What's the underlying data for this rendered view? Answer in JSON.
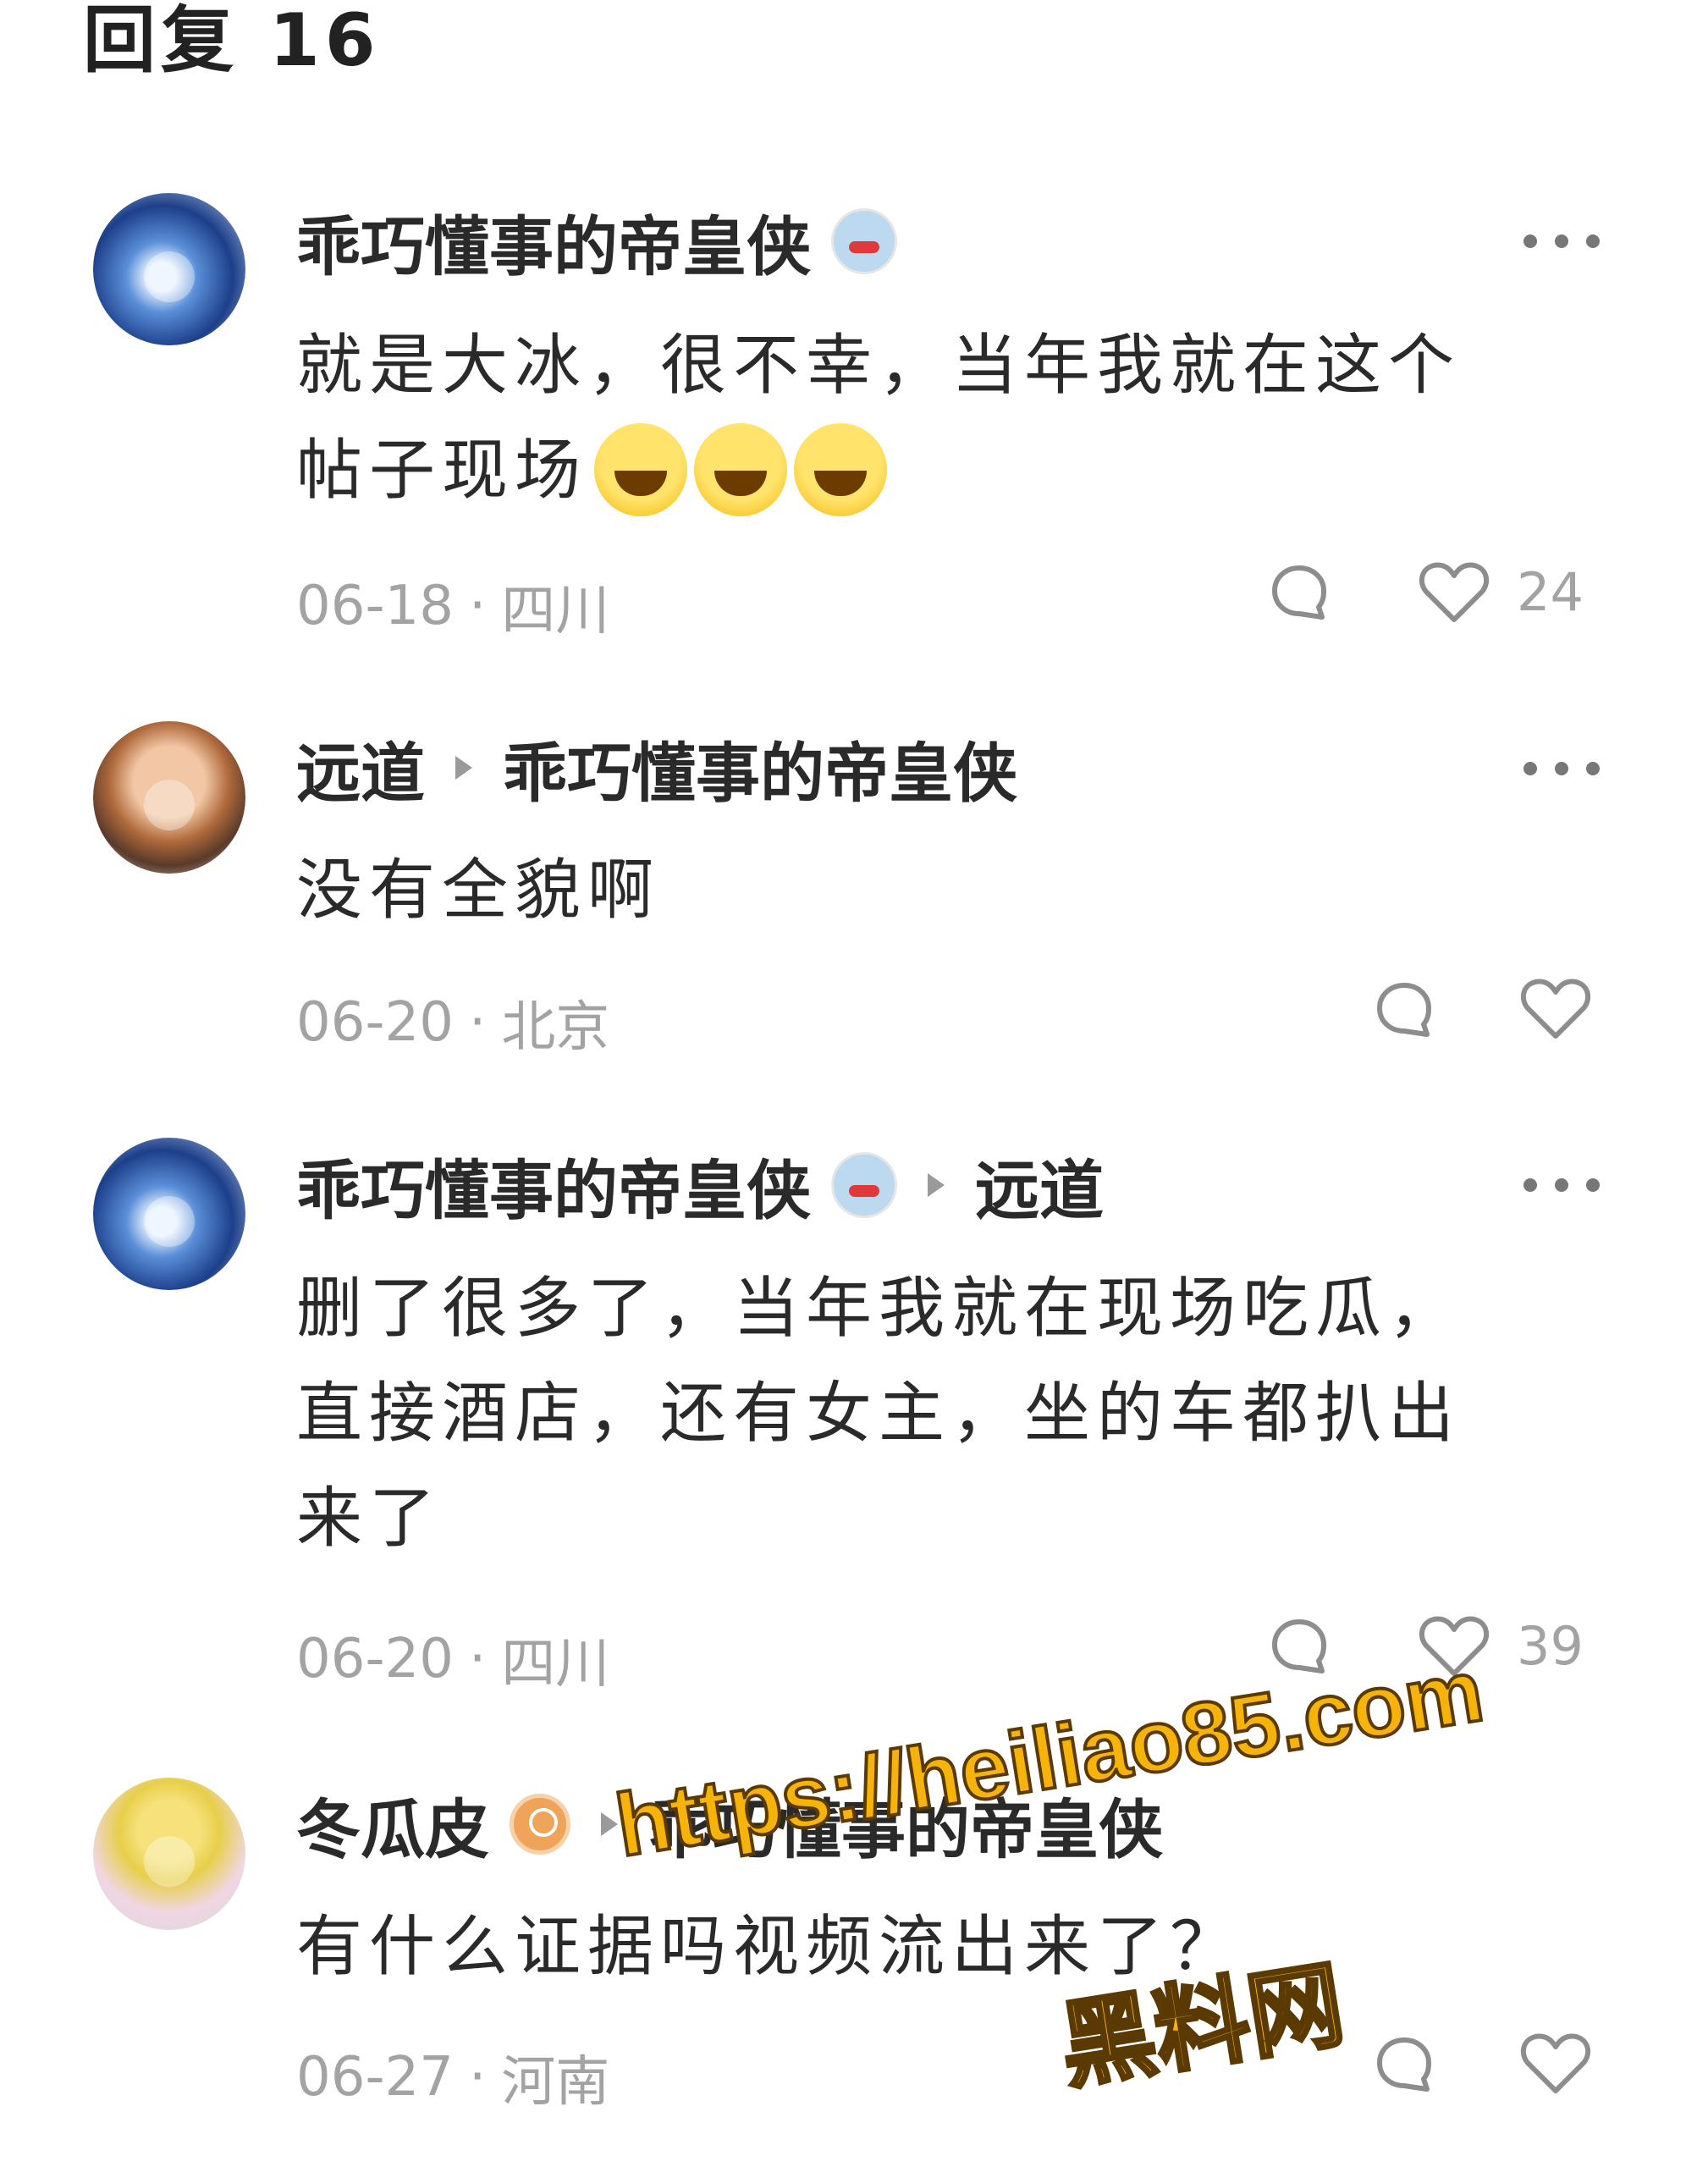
{
  "header": {
    "title": "回复 16"
  },
  "comments": [
    {
      "user": "乖巧懂事的帝皇侠",
      "has_badge": true,
      "reply_to": "",
      "text_lines": [
        "就是大冰，很不幸，当年我就在这个",
        "帖子现场"
      ],
      "emoji_count": 3,
      "date": "06-18",
      "location": "四川",
      "likes": "24"
    },
    {
      "user": "远道",
      "has_badge": false,
      "reply_to": "乖巧懂事的帝皇侠",
      "text_lines": [
        "没有全貌啊"
      ],
      "date": "06-20",
      "location": "北京",
      "likes": ""
    },
    {
      "user": "乖巧懂事的帝皇侠",
      "has_badge": true,
      "reply_to": "远道",
      "text_lines": [
        "删了很多了，当年我就在现场吃瓜，",
        "直接酒店，还有女主，坐的车都扒出",
        "来了"
      ],
      "date": "06-20",
      "location": "四川",
      "likes": "39"
    },
    {
      "user": "冬瓜皮",
      "has_badge": true,
      "reply_to": "乖巧懂事的帝皇侠",
      "text_lines": [
        "有什么证据吗视频流出来了？"
      ],
      "date": "06-27",
      "location": "河南",
      "likes": ""
    }
  ],
  "separator": "·",
  "watermark": {
    "url": "https://heiliao85.com",
    "name": "黑料网"
  },
  "icons": {
    "comment": "speech-bubble-icon",
    "like": "heart-icon",
    "more": "more-dots-icon",
    "reply_arrow": "triangle-right-icon"
  },
  "colors": {
    "meta_gray": "#a3a3a3",
    "watermark": "#f6b40a"
  }
}
